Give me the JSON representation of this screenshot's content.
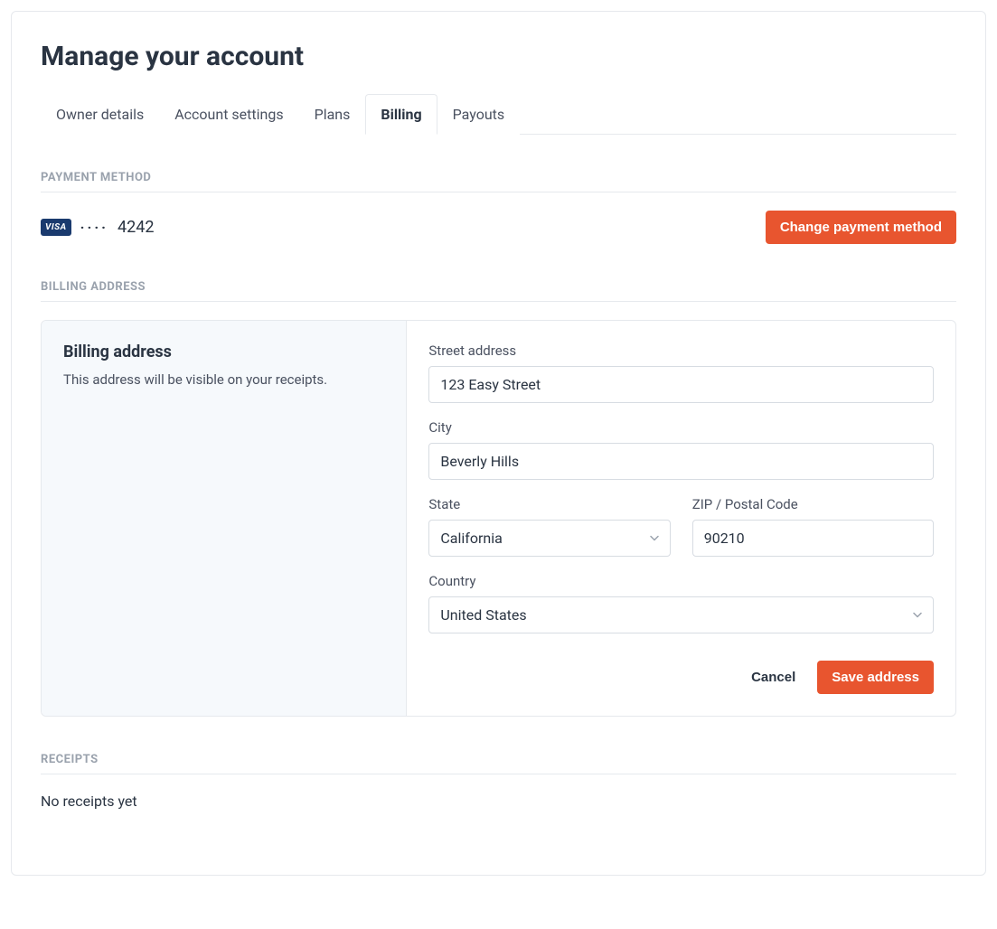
{
  "page": {
    "title": "Manage your account"
  },
  "tabs": {
    "owner_details": "Owner details",
    "account_settings": "Account settings",
    "plans": "Plans",
    "billing": "Billing",
    "payouts": "Payouts"
  },
  "payment": {
    "section_label": "PAYMENT METHOD",
    "card_brand": "VISA",
    "last4": "4242",
    "change_button": "Change payment method"
  },
  "billing_address": {
    "section_label": "BILLING ADDRESS",
    "info_title": "Billing address",
    "info_text": "This address will be visible on your receipts.",
    "labels": {
      "street": "Street address",
      "city": "City",
      "state": "State",
      "zip": "ZIP / Postal Code",
      "country": "Country"
    },
    "values": {
      "street": "123 Easy Street",
      "city": "Beverly Hills",
      "state": "California",
      "zip": "90210",
      "country": "United States"
    },
    "buttons": {
      "cancel": "Cancel",
      "save": "Save address"
    }
  },
  "receipts": {
    "section_label": "RECEIPTS",
    "empty_text": "No receipts yet"
  }
}
